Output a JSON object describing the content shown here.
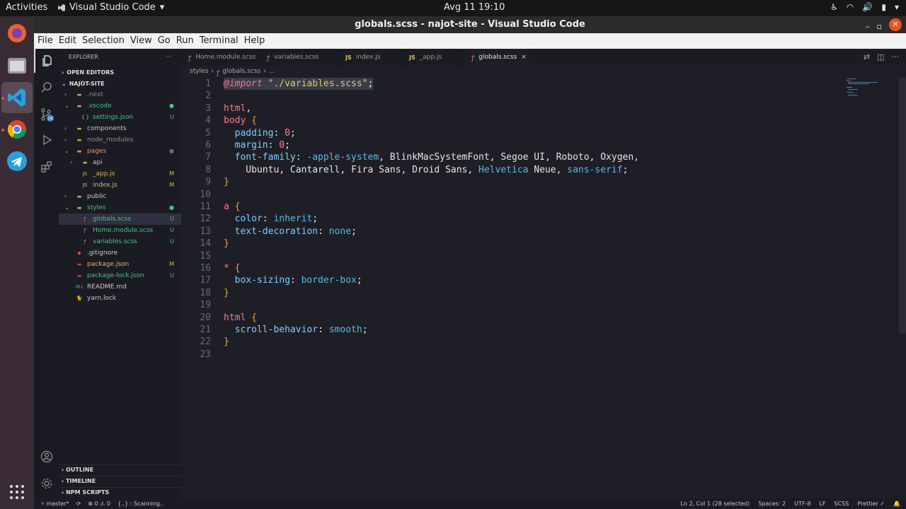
{
  "topbar": {
    "activities": "Activities",
    "app_name": "Visual Studio Code",
    "clock": "Avg 11  19:10"
  },
  "window": {
    "title": "globals.scss - najot-site - Visual Studio Code"
  },
  "menu": [
    "File",
    "Edit",
    "Selection",
    "View",
    "Go",
    "Run",
    "Terminal",
    "Help"
  ],
  "explorer": {
    "header": "EXPLORER",
    "open_editors": "OPEN EDITORS",
    "project": "NAJOT-SITE",
    "items": [
      {
        "label": ".next",
        "indent": 1,
        "type": "folder",
        "chev": ">",
        "color": "#8a8a8a",
        "badge": ""
      },
      {
        "label": ".vscode",
        "indent": 1,
        "type": "folder-open",
        "chev": "v",
        "color": "#4bbf8a",
        "badge": "●",
        "badge_color": "#4bbf8a"
      },
      {
        "label": "settings.json",
        "indent": 2,
        "type": "json",
        "chev": "",
        "color": "#4bbf8a",
        "badge": "U",
        "badge_color": "#4bbf8a"
      },
      {
        "label": "components",
        "indent": 1,
        "type": "folder",
        "chev": ">",
        "color": "#c8c8c8",
        "badge": ""
      },
      {
        "label": "node_modules",
        "indent": 1,
        "type": "folder",
        "chev": ">",
        "color": "#8a8a8a",
        "badge": ""
      },
      {
        "label": "pages",
        "indent": 1,
        "type": "folder-open",
        "chev": "v",
        "color": "#e09a6a",
        "badge": "●",
        "badge_color": "#6d6d6d"
      },
      {
        "label": "api",
        "indent": 2,
        "type": "folder",
        "chev": ">",
        "color": "#c8c8c8",
        "badge": ""
      },
      {
        "label": "_app.js",
        "indent": 2,
        "type": "js",
        "chev": "",
        "color": "#d9b26a",
        "badge": "M",
        "badge_color": "#d9b26a"
      },
      {
        "label": "index.js",
        "indent": 2,
        "type": "js",
        "chev": "",
        "color": "#d9b26a",
        "badge": "M",
        "badge_color": "#d9b26a"
      },
      {
        "label": "public",
        "indent": 1,
        "type": "folder",
        "chev": ">",
        "color": "#c8c8c8",
        "badge": ""
      },
      {
        "label": "styles",
        "indent": 1,
        "type": "folder-open",
        "chev": "v",
        "color": "#4bbf8a",
        "badge": "●",
        "badge_color": "#4bbf8a"
      },
      {
        "label": "globals.scss",
        "indent": 2,
        "type": "scss",
        "chev": "",
        "color": "#4bbf8a",
        "badge": "U",
        "badge_color": "#4bbf8a",
        "selected": true
      },
      {
        "label": "Home.module.scss",
        "indent": 2,
        "type": "scss",
        "chev": "",
        "color": "#4bbf8a",
        "badge": "U",
        "badge_color": "#4bbf8a"
      },
      {
        "label": "variables.scss",
        "indent": 2,
        "type": "scss",
        "chev": "",
        "color": "#4bbf8a",
        "badge": "U",
        "badge_color": "#4bbf8a"
      },
      {
        "label": ".gitignore",
        "indent": 1,
        "type": "git",
        "chev": "",
        "color": "#c8c8c8",
        "badge": ""
      },
      {
        "label": "package.json",
        "indent": 1,
        "type": "npm",
        "chev": "",
        "color": "#d9b26a",
        "badge": "M",
        "badge_color": "#d9b26a"
      },
      {
        "label": "package-lock.json",
        "indent": 1,
        "type": "npm",
        "chev": "",
        "color": "#4bbf8a",
        "badge": "U",
        "badge_color": "#4bbf8a"
      },
      {
        "label": "README.md",
        "indent": 1,
        "type": "md",
        "chev": "",
        "color": "#c8c8c8",
        "badge": ""
      },
      {
        "label": "yarn.lock",
        "indent": 1,
        "type": "yarn",
        "chev": "",
        "color": "#c8c8c8",
        "badge": ""
      }
    ],
    "outline": "OUTLINE",
    "timeline": "TIMELINE",
    "npm_scripts": "NPM SCRIPTS"
  },
  "tabs": [
    {
      "label": "Home.module.scss",
      "icon": "scss"
    },
    {
      "label": "variables.scss",
      "icon": "scss"
    },
    {
      "label": "index.js",
      "icon": "js"
    },
    {
      "label": "_app.js",
      "icon": "js"
    },
    {
      "label": "globals.scss",
      "icon": "scss",
      "active": true
    }
  ],
  "breadcrumb": {
    "folder": "styles",
    "file": "globals.scss",
    "more": "..."
  },
  "code_lines": [
    [
      [
        "@import",
        "k-imp"
      ],
      [
        " ",
        ""
      ],
      [
        "\"./variables.scss\"",
        "k-str"
      ],
      [
        ";",
        "k-pun"
      ]
    ],
    [],
    [
      [
        "html",
        "k-sel"
      ],
      [
        ",",
        "k-pun"
      ]
    ],
    [
      [
        "body",
        "k-sel"
      ],
      [
        " ",
        ""
      ],
      [
        "{",
        "k-br"
      ]
    ],
    [
      [
        "  padding",
        "k-prop"
      ],
      [
        ": ",
        "k-pun"
      ],
      [
        "0",
        "k-num"
      ],
      [
        ";",
        "k-pun"
      ]
    ],
    [
      [
        "  margin",
        "k-prop"
      ],
      [
        ": ",
        "k-pun"
      ],
      [
        "0",
        "k-num"
      ],
      [
        ";",
        "k-pun"
      ]
    ],
    [
      [
        "  font-family",
        "k-prop"
      ],
      [
        ": ",
        "k-pun"
      ],
      [
        "-apple-system",
        "k-val"
      ],
      [
        ", BlinkMacSystemFont, Segoe UI, Roboto, Oxygen,",
        "k-pun"
      ]
    ],
    [
      [
        "    Ubuntu, Cantarell, Fira Sans, Droid Sans, ",
        "k-pun"
      ],
      [
        "Helvetica",
        "k-val"
      ],
      [
        " Neue, ",
        "k-pun"
      ],
      [
        "sans-serif",
        "k-val"
      ],
      [
        ";",
        "k-pun"
      ]
    ],
    [
      [
        "}",
        "k-br"
      ]
    ],
    [],
    [
      [
        "a",
        "k-sel"
      ],
      [
        " ",
        ""
      ],
      [
        "{",
        "k-br"
      ]
    ],
    [
      [
        "  color",
        "k-prop"
      ],
      [
        ": ",
        "k-pun"
      ],
      [
        "inherit",
        "k-val"
      ],
      [
        ";",
        "k-pun"
      ]
    ],
    [
      [
        "  text-decoration",
        "k-prop"
      ],
      [
        ": ",
        "k-pun"
      ],
      [
        "none",
        "k-val"
      ],
      [
        ";",
        "k-pun"
      ]
    ],
    [
      [
        "}",
        "k-br"
      ]
    ],
    [],
    [
      [
        "*",
        "k-sel"
      ],
      [
        " ",
        ""
      ],
      [
        "{",
        "k-br"
      ]
    ],
    [
      [
        "  box-sizing",
        "k-prop"
      ],
      [
        ": ",
        "k-pun"
      ],
      [
        "border-box",
        "k-val"
      ],
      [
        ";",
        "k-pun"
      ]
    ],
    [
      [
        "}",
        "k-br"
      ]
    ],
    [],
    [
      [
        "html",
        "k-sel"
      ],
      [
        " ",
        ""
      ],
      [
        "{",
        "k-br"
      ]
    ],
    [
      [
        "  scroll-behavior",
        "k-prop"
      ],
      [
        ": ",
        "k-pun"
      ],
      [
        "smooth",
        "k-val"
      ],
      [
        ";",
        "k-pun"
      ]
    ],
    [
      [
        "}",
        "k-br"
      ]
    ],
    []
  ],
  "status": {
    "branch": "master*",
    "errors": "0",
    "warnings": "0",
    "scanning": "{..} : Scanning..",
    "position": "Ln 2, Col 1 (28 selected)",
    "spaces": "Spaces: 2",
    "encoding": "UTF-8",
    "eol": "LF",
    "language": "SCSS",
    "formatter": "Prettier"
  }
}
